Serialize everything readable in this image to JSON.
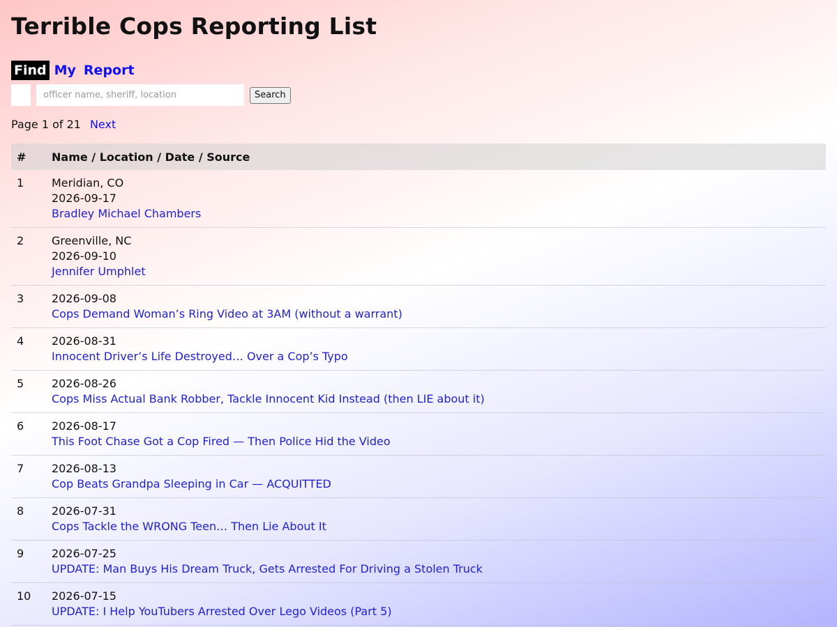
{
  "app": {
    "title": "Terrible Cops Reporting List"
  },
  "nav": {
    "items": [
      {
        "label": "Find",
        "active": true
      },
      {
        "label": "My",
        "active": false
      },
      {
        "label": "Report",
        "active": false
      }
    ]
  },
  "search": {
    "placeholder": "officer name, sheriff, location",
    "value": "",
    "button_label": "Search"
  },
  "pager": {
    "status": "Page 1 of 21",
    "next_label": "Next"
  },
  "table": {
    "headers": [
      "#",
      "Name / Location / Date / Source"
    ],
    "rows": [
      {
        "num": "1",
        "location": "Meridian, CO",
        "date": "2026-09-17",
        "link": "Bradley Michael Chambers"
      },
      {
        "num": "2",
        "location": "Greenville, NC",
        "date": "2026-09-10",
        "link": "Jennifer Umphlet"
      },
      {
        "num": "3",
        "location": "",
        "date": "2026-09-08",
        "link": "Cops Demand Woman’s Ring Video at 3AM (without a warrant)"
      },
      {
        "num": "4",
        "location": "",
        "date": "2026-08-31",
        "link": "Innocent Driver’s Life Destroyed… Over a Cop’s Typo"
      },
      {
        "num": "5",
        "location": "",
        "date": "2026-08-26",
        "link": "Cops Miss Actual Bank Robber, Tackle Innocent Kid Instead (then LIE about it)"
      },
      {
        "num": "6",
        "location": "",
        "date": "2026-08-17",
        "link": "This Foot Chase Got a Cop Fired — Then Police Hid the Video"
      },
      {
        "num": "7",
        "location": "",
        "date": "2026-08-13",
        "link": "Cop Beats Grandpa Sleeping in Car — ACQUITTED"
      },
      {
        "num": "8",
        "location": "",
        "date": "2026-07-31",
        "link": "Cops Tackle the WRONG Teen… Then Lie About It"
      },
      {
        "num": "9",
        "location": "",
        "date": "2026-07-25",
        "link": "UPDATE: Man Buys His Dream Truck, Gets Arrested For Driving a Stolen Truck"
      },
      {
        "num": "10",
        "location": "",
        "date": "2026-07-15",
        "link": "UPDATE: I Help YouTubers Arrested Over Lego Videos (Part 5)"
      }
    ]
  },
  "colors": {
    "link": "#2222cc",
    "nav_link": "#1010ee",
    "nav_active_bg": "#000000",
    "gradient_top": "#ffc6c6",
    "gradient_bottom": "#b3b3ff"
  }
}
